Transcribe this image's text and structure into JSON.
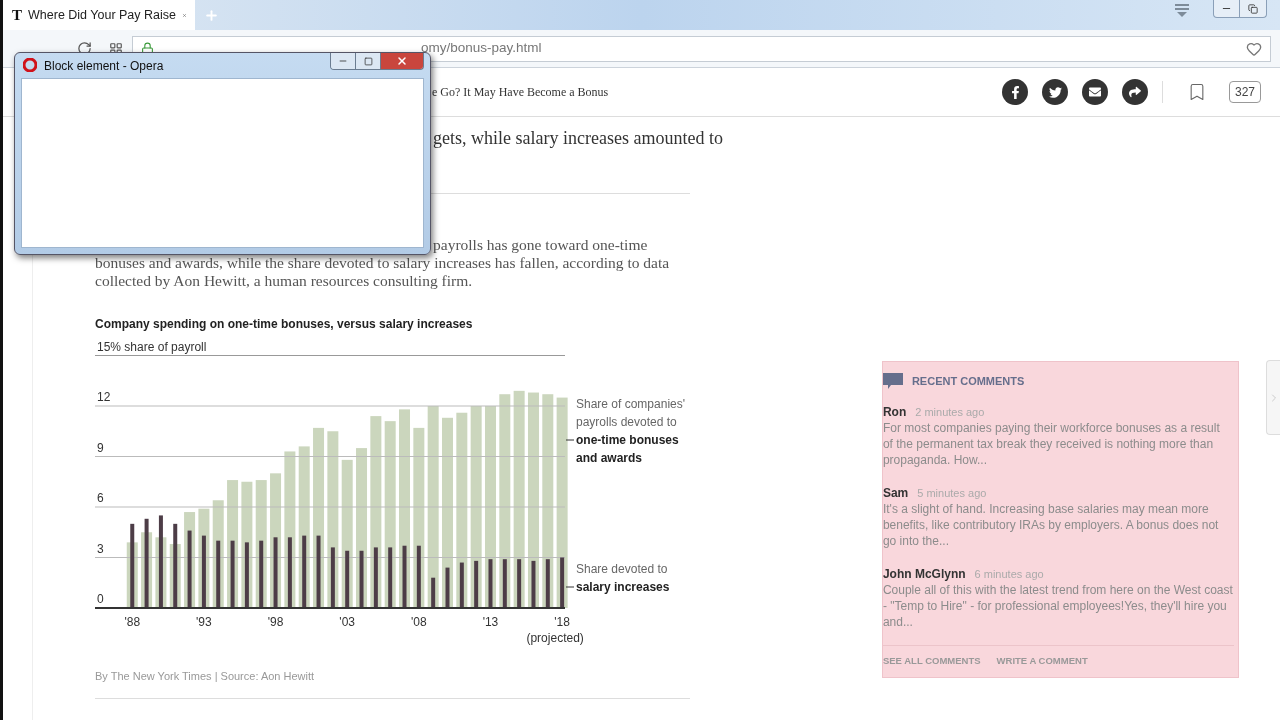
{
  "browser": {
    "tab": {
      "logo": "T",
      "title": "Where Did Your Pay Raise"
    },
    "address": {
      "url": "omy/bonus-pay.html"
    }
  },
  "popup": {
    "title": "Block element - Opera"
  },
  "header": {
    "headline": "e Go? It May Have Become a Bonus",
    "comment_count": "327"
  },
  "article": {
    "text_fragment": "gets, while salary increases amounted to",
    "paragraph": "payrolls has gone toward one-time bonuses and awards, while the share devoted to salary increases has fallen, according to data collected by Aon Hewitt, a human resources consulting firm.",
    "chart": {
      "chart_data": {
        "type": "bar",
        "title": "Company spending on one-time bonuses, versus salary increases",
        "x": [
          1988,
          1989,
          1990,
          1991,
          1992,
          1993,
          1994,
          1995,
          1996,
          1997,
          1998,
          1999,
          2000,
          2001,
          2002,
          2003,
          2004,
          2005,
          2006,
          2007,
          2008,
          2009,
          2010,
          2011,
          2012,
          2013,
          2014,
          2015,
          2016,
          2017,
          2018
        ],
        "series": [
          {
            "name": "Share of companies' payrolls devoted to **one-time bonuses and awards**",
            "color": "#cbd6bd",
            "values": [
              3.9,
              4.5,
              4.2,
              3.8,
              5.7,
              5.9,
              6.4,
              7.6,
              7.5,
              7.6,
              8.0,
              9.3,
              9.6,
              10.7,
              10.5,
              8.8,
              9.5,
              11.4,
              11.1,
              11.8,
              10.7,
              12.0,
              11.3,
              11.6,
              12.0,
              12.0,
              12.7,
              12.9,
              12.8,
              12.7,
              12.5
            ]
          },
          {
            "name": "Share devoted to **salary increases**",
            "color": "#4d3d47",
            "values": [
              5.0,
              5.3,
              5.5,
              5.0,
              4.6,
              4.3,
              4.0,
              4.0,
              3.9,
              4.0,
              4.2,
              4.2,
              4.3,
              4.3,
              3.6,
              3.4,
              3.4,
              3.6,
              3.6,
              3.7,
              3.7,
              1.8,
              2.4,
              2.7,
              2.8,
              2.9,
              2.9,
              2.9,
              2.8,
              2.9,
              3.0
            ]
          }
        ],
        "xlim": [
          1985.4,
          2018.2
        ],
        "ylim": [
          0,
          15
        ],
        "grid": true,
        "yticks": [
          0,
          3,
          6,
          9,
          12,
          {
            "value": 15,
            "label": "15% share of payroll"
          }
        ],
        "xticks": [
          {
            "value": 1988,
            "label": "'88"
          },
          {
            "value": 1993,
            "label": "'93"
          },
          {
            "value": 1998,
            "label": "'98"
          },
          {
            "value": 2003,
            "label": "'03"
          },
          {
            "value": 2008,
            "label": "'08"
          },
          {
            "value": 2013,
            "label": "'13"
          },
          {
            "value": 2018,
            "label": "'18"
          }
        ],
        "annotations": [
          "(projected)"
        ]
      }
    },
    "credit": "By The New York Times | Source: Aon Hewitt"
  },
  "comments": {
    "heading": "RECENT COMMENTS",
    "items": [
      {
        "author": "Ron",
        "time": "2 minutes ago",
        "text": "For most companies paying their workforce bonuses as a result of the permanent tax break they received is nothing more than propaganda. How..."
      },
      {
        "author": "Sam",
        "time": "5 minutes ago",
        "text": "It's a slight of hand. Increasing base salaries may mean more benefits, like contributory IRAs by employers. A bonus does not go into the..."
      },
      {
        "author": "John McGlynn",
        "time": "6 minutes ago",
        "text": "Couple all of this with the latest trend from here on the West coast - \"Temp to Hire\" - for professional employees!Yes, they'll hire you and..."
      }
    ],
    "links": [
      "SEE ALL COMMENTS",
      "WRITE A COMMENT"
    ]
  }
}
